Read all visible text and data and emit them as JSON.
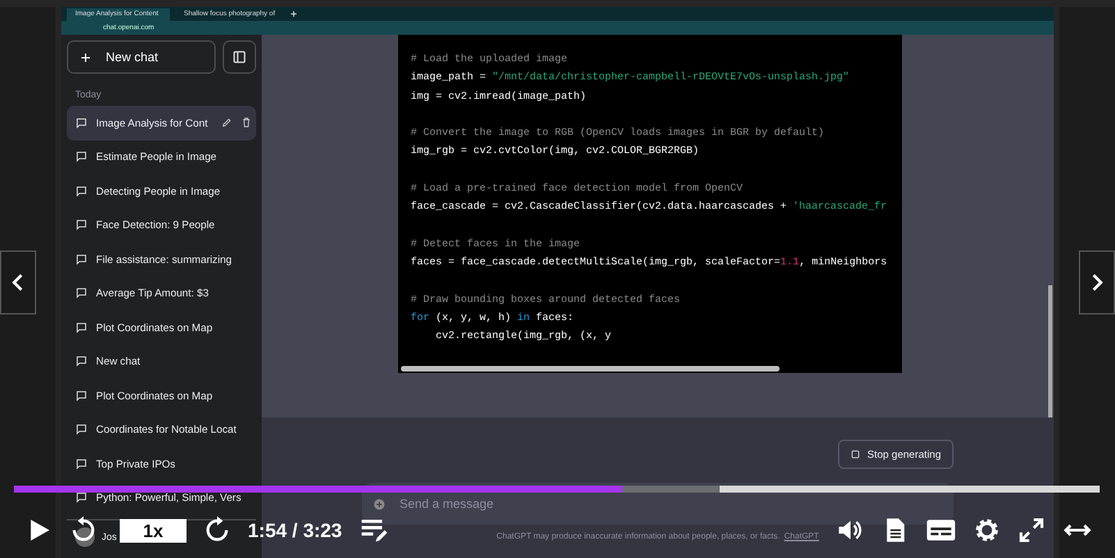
{
  "browser": {
    "tabs": [
      {
        "title": "Image Analysis for Content",
        "selected": true
      },
      {
        "title": "Shallow focus photography of",
        "selected": false
      }
    ],
    "address": "chat.openai.com"
  },
  "sidebar": {
    "new_chat": "New chat",
    "section": "Today",
    "items": [
      {
        "label": "Image Analysis for Cont",
        "selected": true
      },
      {
        "label": "Estimate People in Image",
        "selected": false
      },
      {
        "label": "Detecting People in Image",
        "selected": false
      },
      {
        "label": "Face Detection: 9 People",
        "selected": false
      },
      {
        "label": "File assistance: summarizing",
        "selected": false
      },
      {
        "label": "Average Tip Amount: $3",
        "selected": false
      },
      {
        "label": "Plot Coordinates on Map",
        "selected": false
      },
      {
        "label": "New chat",
        "selected": false
      },
      {
        "label": "Plot Coordinates on Map",
        "selected": false
      },
      {
        "label": "Coordinates for Notable Locat",
        "selected": false
      },
      {
        "label": "Top Private IPOs",
        "selected": false
      },
      {
        "label": "Python: Powerful, Simple, Vers",
        "selected": false
      }
    ],
    "user": "Jos"
  },
  "code": [
    [
      [
        {
          "kind": "comment",
          "text": "# Load the uploaded image"
        }
      ],
      [
        {
          "kind": "plain",
          "text": "image_path = "
        },
        {
          "kind": "string",
          "text": "\"/mnt/data/christopher-campbell-rDEOVtE7vOs-unsplash.jpg\""
        }
      ],
      [
        {
          "kind": "plain",
          "text": "img = cv2.imread(image_path)"
        }
      ]
    ],
    [
      [
        {
          "kind": "comment",
          "text": "# Convert the image to RGB (OpenCV loads images in BGR by default)"
        }
      ],
      [
        {
          "kind": "plain",
          "text": "img_rgb = cv2.cvtColor(img, cv2.COLOR_BGR2RGB)"
        }
      ]
    ],
    [
      [
        {
          "kind": "comment",
          "text": "# Load a pre-trained face detection model from OpenCV"
        }
      ],
      [
        {
          "kind": "plain",
          "text": "face_cascade = cv2.CascadeClassifier(cv2.data.haarcascades + "
        },
        {
          "kind": "string",
          "text": "'haarcascade_fr"
        }
      ]
    ],
    [
      [
        {
          "kind": "comment",
          "text": "# Detect faces in the image"
        }
      ],
      [
        {
          "kind": "plain",
          "text": "faces = face_cascade.detectMultiScale(img_rgb, scaleFactor="
        },
        {
          "kind": "number",
          "text": "1.1"
        },
        {
          "kind": "plain",
          "text": ", minNeighbors"
        }
      ]
    ],
    [
      [
        {
          "kind": "comment",
          "text": "# Draw bounding boxes around detected faces"
        }
      ],
      [
        {
          "kind": "keyword",
          "text": "for"
        },
        {
          "kind": "plain",
          "text": " (x, y, w, h) "
        },
        {
          "kind": "keyword",
          "text": "in"
        },
        {
          "kind": "plain",
          "text": " faces:"
        }
      ],
      [
        {
          "kind": "plain",
          "text": "    cv2.rectangle(img_rgb, (x, y"
        }
      ]
    ]
  ],
  "stop_button": "Stop generating",
  "composer": {
    "placeholder": "Send a message"
  },
  "footer": {
    "text": "ChatGPT may produce inaccurate information about people, places, or facts.",
    "link": "ChatGPT"
  },
  "player": {
    "progress": {
      "level": 0.56
    },
    "buffer": {
      "level": 0.65
    },
    "speed": "1x",
    "time": "1:54 / 3:23"
  }
}
